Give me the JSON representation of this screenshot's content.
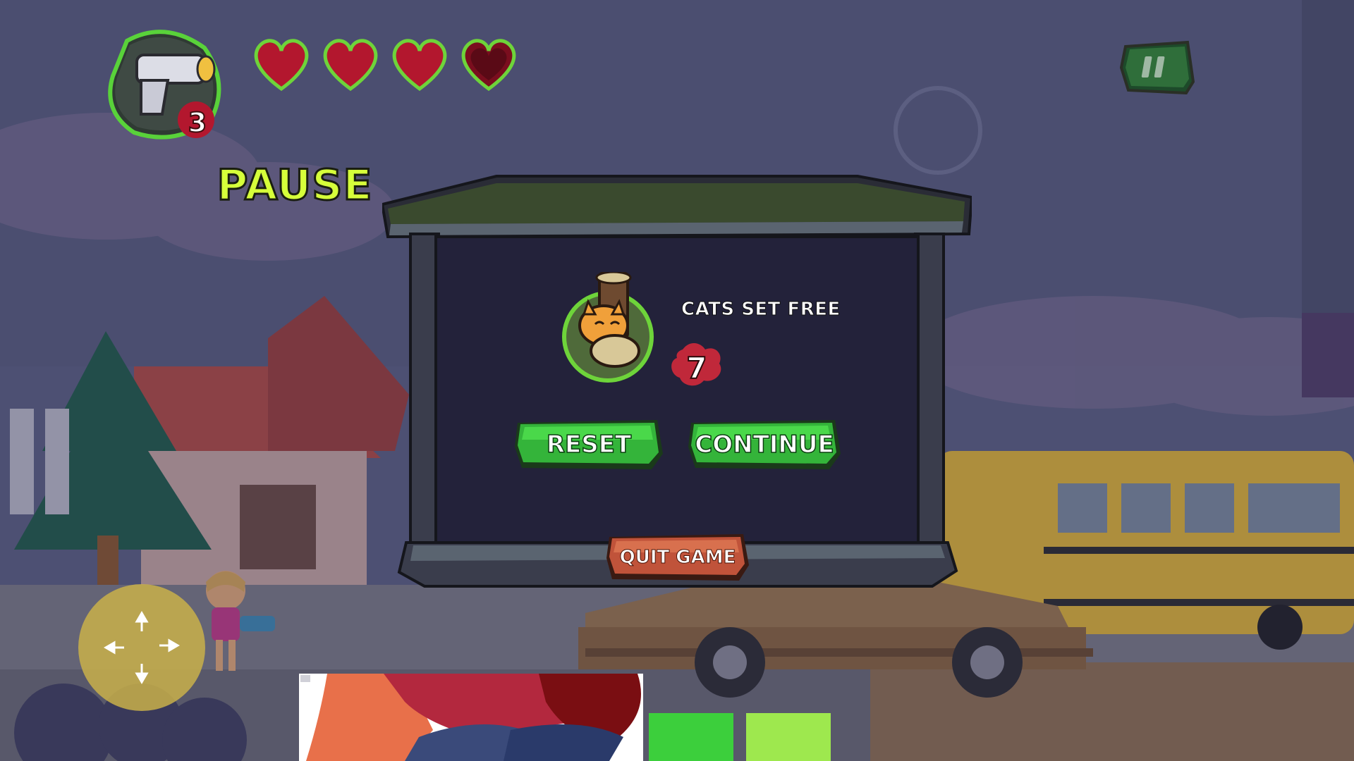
{
  "title": "PAUSE",
  "hud": {
    "weapon_icon": "blaster-icon",
    "ammo_count": "3",
    "hearts": [
      {
        "icon": "heart-icon",
        "state": "full"
      },
      {
        "icon": "heart-icon",
        "state": "full"
      },
      {
        "icon": "heart-icon",
        "state": "full"
      },
      {
        "icon": "heart-icon",
        "state": "empty"
      }
    ],
    "pause_icon": "pause-icon"
  },
  "stats": {
    "label": "CATS SET FREE",
    "value": "7",
    "icon": "rescued-cat-icon",
    "badge_icon": "paw-badge-icon"
  },
  "buttons": {
    "reset": "RESET",
    "continue": "CONTINUE",
    "quit": "QUIT GAME"
  },
  "joystick": {
    "icon": "dpad-arrows-icon"
  },
  "colors": {
    "accent_green": "#3ccf3c",
    "title_yellow": "#d6ff3a",
    "quit_orange": "#d2613e",
    "heart_red": "#b3172e",
    "panel_dark": "#23223a"
  }
}
